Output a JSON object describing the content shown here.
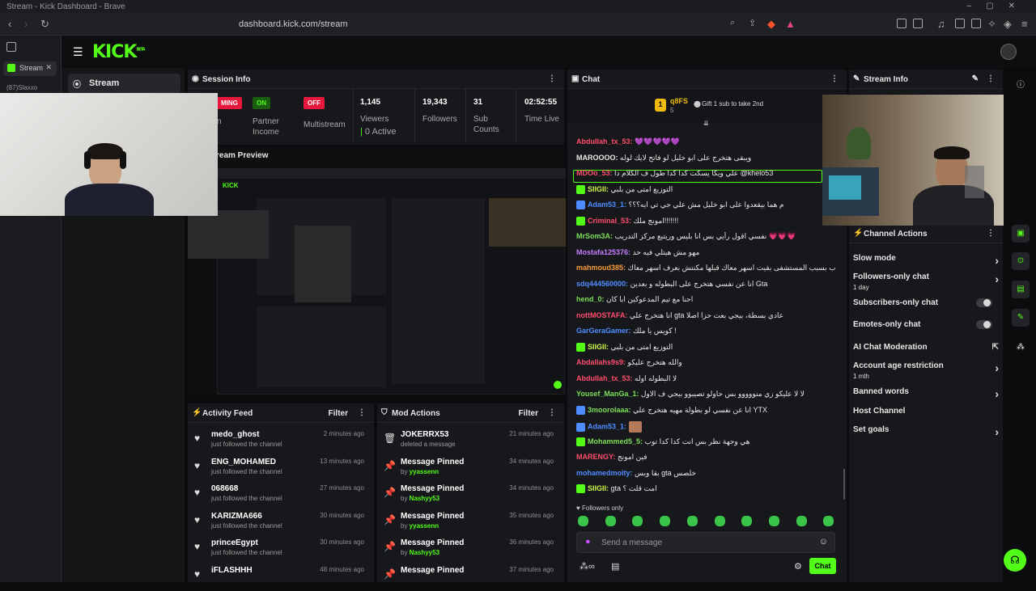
{
  "browser": {
    "window_title": "Stream - Kick Dashboard - Brave",
    "url": "dashboard.kick.com/stream",
    "tabs": [
      {
        "label": "Stream"
      },
      {
        "label": "(87)Slaxxo"
      }
    ]
  },
  "app": {
    "logo": "KICK",
    "logo_sup": "BETA",
    "nav": {
      "stream_label": "Stream"
    }
  },
  "session_info": {
    "title": "Session Info",
    "preview_title": "Stream Preview",
    "live_badge": "MING",
    "live_suffix": "n",
    "partner": {
      "badge": "ON",
      "label_1": "Partner",
      "label_2": "Income"
    },
    "multistream": {
      "badge": "OFF",
      "label": "Multistream"
    },
    "viewers": {
      "value": "1,145",
      "label": "Viewers",
      "active": "0 Active"
    },
    "followers": {
      "value": "19,343",
      "label": "Followers"
    },
    "sub_counts": {
      "value": "31",
      "label_1": "Sub",
      "label_2": "Counts"
    },
    "live_time": {
      "value": "02:52:55",
      "label": "Time Live"
    }
  },
  "activity_feed": {
    "title": "Activity Feed",
    "filter_label": "Filter",
    "items": [
      {
        "name": "medo_ghost",
        "action": "just followed the channel",
        "time": "2 minutes ago"
      },
      {
        "name": "ENG_MOHAMED",
        "action": "just followed the channel",
        "time": "13 minutes ago"
      },
      {
        "name": "068668",
        "action": "just followed the channel",
        "time": "27 minutes ago"
      },
      {
        "name": "KARIZMA666",
        "action": "just followed the channel",
        "time": "30 minutes ago"
      },
      {
        "name": "princeEgypt",
        "action": "just followed the channel",
        "time": "30 minutes ago"
      },
      {
        "name": "iFLASHHH",
        "action": "",
        "time": "48 minutes ago"
      }
    ]
  },
  "mod_actions": {
    "title": "Mod Actions",
    "filter_label": "Filter",
    "items": [
      {
        "name": "JOKERRX53",
        "detail": "deleted a message",
        "by": "",
        "time": "21 minutes ago",
        "icon": "trash-icon"
      },
      {
        "name": "Message Pinned",
        "detail": "by",
        "by": "yyassenn",
        "time": "34 minutes ago",
        "icon": "pin-icon"
      },
      {
        "name": "Message Pinned",
        "detail": "by",
        "by": "Nashyy53",
        "time": "34 minutes ago",
        "icon": "pin-icon"
      },
      {
        "name": "Message Pinned",
        "detail": "by",
        "by": "yyassenn",
        "time": "35 minutes ago",
        "icon": "pin-icon"
      },
      {
        "name": "Message Pinned",
        "detail": "by",
        "by": "Nashyy53",
        "time": "36 minutes ago",
        "icon": "pin-icon"
      },
      {
        "name": "Message Pinned",
        "detail": "",
        "by": "",
        "time": "37 minutes ago",
        "icon": "pin-icon"
      }
    ]
  },
  "chat": {
    "title": "Chat",
    "pinned_user": "q8FS",
    "pinned_count": "5",
    "pinned_text": "Gift 1 sub to take 2nd",
    "messages": [
      {
        "user": "Abdullah_tx_53:",
        "text": "💜💜💜💜💜",
        "color": "#ff4d6d"
      },
      {
        "user": "MAROOOO:",
        "text": "ويبقى هتخرج على ابو خليل لو فاتح لايك لوله",
        "color": "#e8e8e8"
      },
      {
        "user": "MDOo_53:",
        "text": "علي ويكا يسكت كدا كدا طول ف الكلام دا @khelo53",
        "color": "#ff4d6d"
      },
      {
        "user": "SIIGII:",
        "text": "التوزيع امتى من بلبي",
        "color": "#c8f54b"
      },
      {
        "user": "Adam53_1:",
        "text": "م هما بيقعدوا على ابو خليل مش علي جي تي ايه؟؟؟",
        "color": "#4d8dff"
      },
      {
        "user": "Criminal_53:",
        "text": "امونج ملك!!!!!!!",
        "color": "#ff4d6d"
      },
      {
        "user": "MrSom3A:",
        "text": "نفسي اقول رأيي بس انا بليس وريتبع مركز التدريب 💗💗💗",
        "color": "#7dde5b"
      },
      {
        "user": "Mostafa125376:",
        "text": "مهو مش هيتلي فيه حد",
        "color": "#c77dff"
      },
      {
        "user": "mahmoud385:",
        "text": "لما نومي خرب بسبب المستشفى بقيت اسهر معاك قبلها مكنتش بعرف اسهر معاك",
        "color": "#ff9a3c"
      },
      {
        "user": "sdq444560000:",
        "text": "انا عن نفسي هتخرج على البطوله و بعدين Gta",
        "color": "#4d8dff"
      },
      {
        "user": "hend_0:",
        "text": "احنا مع تيم المدعوكين ابا كان",
        "color": "#7dde5b"
      },
      {
        "user": "nottMOSTAFA:",
        "text": "انا هتخرج علي gta عادي بسطة، بيجي بعت حزا اصلا",
        "color": "#ff4d6d"
      },
      {
        "user": "GarGeraGamer:",
        "text": "كويس يا ملك !",
        "color": "#4d8dff"
      },
      {
        "user": "SIIGII:",
        "text": "التوزيع امتى من بلبي",
        "color": "#c8f54b"
      },
      {
        "user": "Abdallahs9s9:",
        "text": "والله هتخرج عليكو",
        "color": "#ff4d6d"
      },
      {
        "user": "Abdullah_tx_53:",
        "text": "لا البطوله اوله",
        "color": "#ff4d6d"
      },
      {
        "user": "Yousef_ManGa_1:",
        "text": "لا لا عليكو زي منووووو بس حاولو تصيبوو بيجي ف الاول",
        "color": "#7dde5b"
      },
      {
        "user": "3moorolaaa:",
        "text": "انا عن نفسي لو بطولة مهيه هتخرج علي YTX",
        "color": "#7dde5b"
      },
      {
        "user": "Adam53_1:",
        "text": "",
        "color": "#4d8dff"
      },
      {
        "user": "Mohammed5_5:",
        "text": "هي وجهة نظر بس انت كدا كدا توب",
        "color": "#7dde5b"
      },
      {
        "user": "MARENGY:",
        "text": "فين امونج",
        "color": "#ff4d6d"
      },
      {
        "user": "mohamedmoity:",
        "text": "بقا وبس gta خلصس",
        "color": "#4d8dff"
      },
      {
        "user": "SIIGII:",
        "text": "gta امت قلت ؟",
        "color": "#c8f54b"
      }
    ],
    "followers_only": "Followers only",
    "input_placeholder": "Send a message",
    "send_label": "Chat"
  },
  "stream_info": {
    "title": "Stream Info"
  },
  "channel_actions": {
    "title": "Channel Actions",
    "items": [
      {
        "label": "Slow mode",
        "sub": "",
        "control": "chevron"
      },
      {
        "label": "Followers-only chat",
        "sub": "1 day",
        "control": "chevron"
      },
      {
        "label": "Subscribers-only chat",
        "sub": "",
        "control": "toggle"
      },
      {
        "label": "Emotes-only chat",
        "sub": "",
        "control": "toggle"
      },
      {
        "label": "AI Chat Moderation",
        "sub": "",
        "control": "external"
      },
      {
        "label": "Account age restriction",
        "sub": "1 mth",
        "control": "chevron"
      },
      {
        "label": "Banned words",
        "sub": "",
        "control": "chevron"
      },
      {
        "label": "Host Channel",
        "sub": "",
        "control": "none"
      },
      {
        "label": "Set goals",
        "sub": "",
        "control": "chevron"
      }
    ]
  },
  "colors": {
    "accent": "#53fc18",
    "live_red": "#e8173c",
    "panel_bg": "#17181b"
  }
}
